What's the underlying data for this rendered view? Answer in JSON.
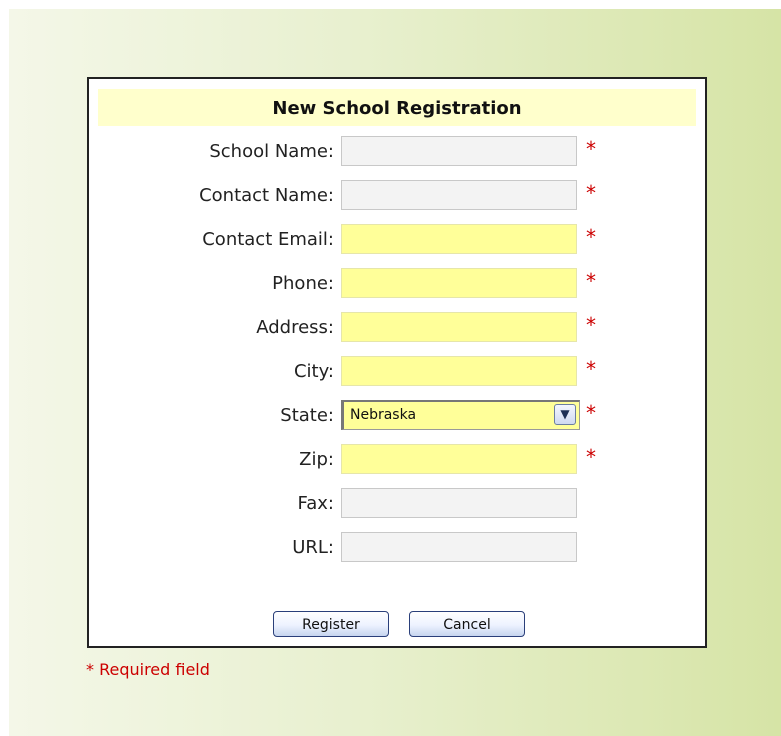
{
  "form": {
    "title": "New School Registration",
    "fields": [
      {
        "label": "School Name:",
        "value": "",
        "required": true,
        "highlighted": false
      },
      {
        "label": "Contact Name:",
        "value": "",
        "required": true,
        "highlighted": false
      },
      {
        "label": "Contact Email:",
        "value": "",
        "required": true,
        "highlighted": true
      },
      {
        "label": "Phone:",
        "value": "",
        "required": true,
        "highlighted": true
      },
      {
        "label": "Address:",
        "value": "",
        "required": true,
        "highlighted": true
      },
      {
        "label": "City:",
        "value": "",
        "required": true,
        "highlighted": true
      },
      {
        "label": "State:",
        "value": "Nebraska",
        "required": true,
        "highlighted": true,
        "type": "select"
      },
      {
        "label": "Zip:",
        "value": "",
        "required": true,
        "highlighted": true
      },
      {
        "label": "Fax:",
        "value": "",
        "required": false,
        "highlighted": false
      },
      {
        "label": "URL:",
        "value": "",
        "required": false,
        "highlighted": false
      }
    ],
    "required_mark": "*",
    "buttons": {
      "register": "Register",
      "cancel": "Cancel"
    }
  },
  "footer": {
    "required_note": "* Required field"
  },
  "colors": {
    "required_field_background": "#ffff99",
    "optional_field_background": "#f3f3f3",
    "required_mark": "#cc0000",
    "title_background": "#ffffcc"
  },
  "icons": {
    "select_arrow": "chevron-down-icon"
  }
}
